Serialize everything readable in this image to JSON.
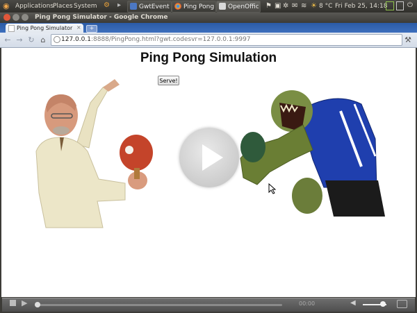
{
  "panel": {
    "menus": [
      "Applications",
      "Places",
      "System"
    ],
    "tasks": [
      {
        "label": "GwtEvent...",
        "active": false
      },
      {
        "label": "Ping Pong...",
        "active": false
      },
      {
        "label": "OpenOffic...",
        "active": true
      }
    ],
    "weather": "8 °C",
    "clock": "Fri Feb 25, 14:18"
  },
  "window": {
    "title": "Ping Pong Simulator - Google Chrome"
  },
  "browser": {
    "tab_title": "Ping Pong Simulator",
    "tab_close": "×",
    "new_tab": "+",
    "url_host": "127.0.0.1",
    "url_rest": ":8888/PingPong.html?gwt.codesvr=127.0.0.1:9997"
  },
  "page": {
    "heading": "Ping Pong Simulation",
    "serve_button": "Serve!"
  },
  "video": {
    "time": "00:00",
    "progress": 0,
    "volume": 0.85
  },
  "colors": {
    "chrome_tab_blue": "#3d6fbd",
    "panel_dark": "#3c3b37",
    "close_btn": "#e2573a"
  }
}
